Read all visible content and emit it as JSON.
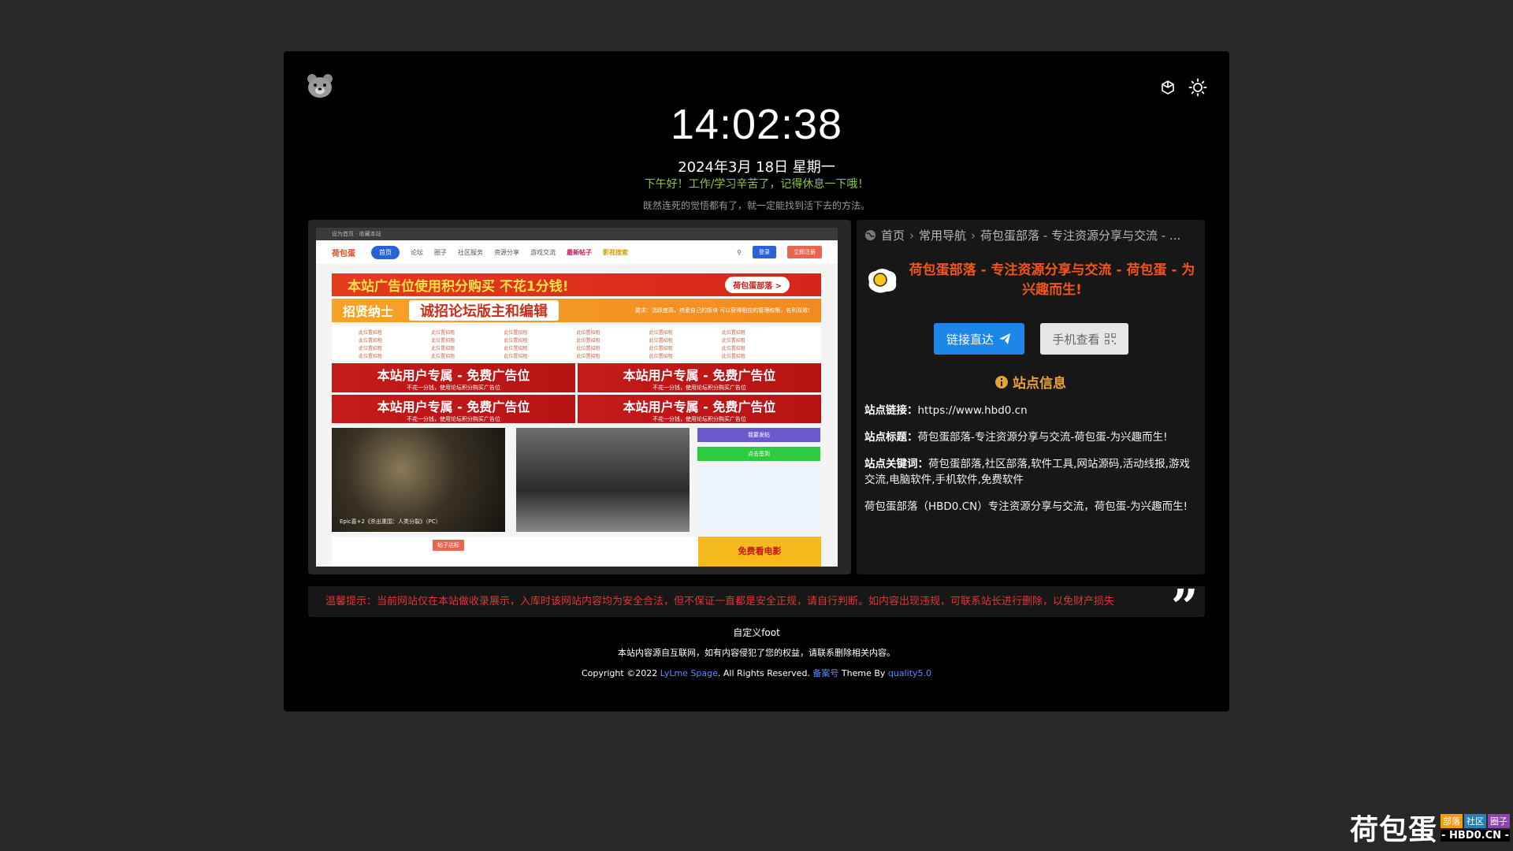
{
  "clock": {
    "time": "14:02:38",
    "date": "2024年3月 18日 星期一",
    "greeting": "下午好！工作/学习辛苦了，记得休息一下哦！",
    "motto": "既然连死的觉悟都有了，就一定能找到活下去的方法。"
  },
  "header": {
    "logo_icon": "bear-logo-icon",
    "icons": [
      "cube-icon",
      "sun-icon"
    ]
  },
  "preview": {
    "topbar": "设为首页 · 收藏本站",
    "logo": "荷包蛋",
    "nav": [
      "首页",
      "论坛",
      "圈子",
      "社区服务",
      "资源分享",
      "游戏交流",
      "最新帖子",
      "影视搜索"
    ],
    "login": "登录",
    "register": "立即注册",
    "banner1": "本站广告位使用积分购买 不花1分钱!",
    "banner1_chip": "荷包蛋部落 >",
    "banner2_left": "招贤纳士",
    "banner2_big": "诚招论坛版主和编辑",
    "banner2_small": "要求：活跃度高，热爱自己的板块 可以获得相应的管理权限，名利双收!",
    "link_text": "此位置招租",
    "ads": [
      {
        "title": "本站用户专属 - 免费广告位",
        "sub": "不花一分钱，使用论坛积分购买广告位"
      },
      {
        "title": "本站用户专属 - 免费广告位",
        "sub": "不花一分钱，使用论坛积分购买广告位"
      },
      {
        "title": "本站用户专属 - 免费广告位",
        "sub": "不花一分钱，使用论坛积分购买广告位"
      },
      {
        "title": "本站用户专属 - 免费广告位",
        "sub": "不花一分钱，使用论坛积分购买广告位"
      }
    ],
    "img_caption": "Epic喜+2《杀出重围：人类分裂》（PC）",
    "side_btn1": "我要发帖",
    "side_btn2": "点击签到",
    "tag": "帖子达标",
    "movie": "免费看电影"
  },
  "info": {
    "breadcrumb": [
      "首页",
      "常用导航",
      "荷包蛋部落 - 专注资源分享与交流 - ..."
    ],
    "site_title": "荷包蛋部落 - 专注资源分享与交流 - 荷包蛋 - 为兴趣而生!",
    "btn_go": "链接直达",
    "btn_mobile": "手机查看",
    "section_title": "站点信息",
    "link_label": "站点链接：",
    "link_value": "https://www.hbd0.cn",
    "title_label": "站点标题：",
    "title_value": "荷包蛋部落-专注资源分享与交流-荷包蛋-为兴趣而生!",
    "keywords_label": "站点关键词：",
    "keywords_value": "荷包蛋部落,社区部落,软件工具,网站源码,活动线报,游戏交流,电脑软件,手机软件,免费软件",
    "description": "荷包蛋部落（HBD0.CN）专注资源分享与交流，荷包蛋-为兴趣而生!"
  },
  "notice": "温馨提示：当前网站仅在本站做收录展示，入库时该网站内容均为安全合法，但不保证一直都是安全正规，请自行判断。如内容出现违规，可联系站长进行删除，以免财产损失",
  "footer": {
    "custom": "自定义foot",
    "disclaimer": "本站内容源自互联网，如有内容侵犯了您的权益，请联系删除相关内容。",
    "copy_prefix": "Copyright ©2022 ",
    "copy_link": "LyLme Spage",
    "copy_mid": ". All Rights Reserved. ",
    "beian": "备案号",
    "theme_by": " Theme By ",
    "theme_link": "quality5.0"
  },
  "watermark": {
    "big": "荷包蛋",
    "tags": [
      "部落",
      "社区",
      "圈子"
    ],
    "domain": "- HBD0.CN -"
  },
  "colors": {
    "accent_orange": "#f2541b",
    "link_blue": "#1c87e8",
    "notice_red": "#e23535",
    "greeting_green": "#8dc63f"
  }
}
